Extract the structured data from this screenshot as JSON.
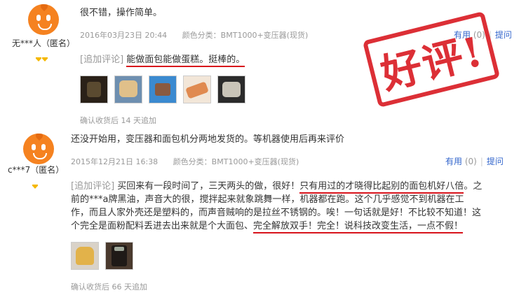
{
  "reviews": [
    {
      "username": "无***人（匿名）",
      "content": "很不错，操作简单。",
      "date": "2016年03月23日 20:44",
      "color_label": "颜色分类：BMT1000+变压器(现货)",
      "useful_label": "有用",
      "useful_count": "(0)",
      "ask_label": "提问",
      "followup_tag": "[追加评论]",
      "followup_text": "能做面包能做蛋糕。挺棒的。",
      "confirm": "确认收货后 14 天追加",
      "thumbnail_count": 5
    },
    {
      "username": "c***7（匿名）",
      "content": "还没开始用，变压器和面包机分两地发货的。等机器使用后再来评价",
      "date": "2015年12月21日 16:38",
      "color_label": "颜色分类：BMT1000+变压器(现货)",
      "useful_label": "有用",
      "useful_count": "(0)",
      "ask_label": "提问",
      "followup_tag": "[追加评论]",
      "followup_line1_plain": " 买回来有一段时间了，三天两头的做，很好！",
      "followup_line1_ul": "只有用过的才晓得比起别的面包机好八倍",
      "followup_line1_end": "。之",
      "followup_line2": "前的***a牌黑油，声音大的很，搅拌起来就象跳舞一样，机器都在跑。这个几乎感觉不到机器在工",
      "followup_line3": "作，而且人家外壳还是塑料的，而声音贼响的是拉丝不锈钢的。唉！一句话就是好！不比较不知道！这",
      "followup_line4_plain": "个完全是面粉配料丢进去出来就是个大面包、",
      "followup_line4_ul": "完全解放双手！完全！说科技改变生活，一点不假！",
      "confirm": "确认收货后 66 天追加",
      "thumbnail_count": 2
    }
  ],
  "stamp_text": "好评!",
  "colors": {
    "accent_red": "#d8131b",
    "link_blue": "#3366cc",
    "avatar_orange": "#f58220",
    "meta_gray": "#999999"
  }
}
